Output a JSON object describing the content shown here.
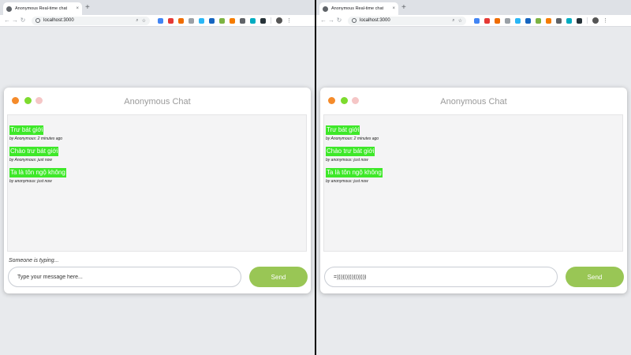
{
  "browser": {
    "tab_title": "Anonymous Real-time chat",
    "url": "localhost:3000",
    "nav": {
      "back": "←",
      "forward": "→",
      "reload": "↻",
      "new_tab": "+",
      "close_tab": "×",
      "zoom": "⌕",
      "bookmark": "☆",
      "menu": "⋮"
    }
  },
  "extensions": [
    "#4285f4",
    "#e53935",
    "#ef6c00",
    "#9aa0a6",
    "#29b6f6",
    "#1565c0",
    "#7cb342",
    "#f57c00",
    "#5f6368",
    "#00acc1",
    "#263238"
  ],
  "panes": [
    {
      "chat_title": "Anonymous Chat",
      "messages": [
        {
          "text": "Trư bát giới",
          "meta": "by Anonymous: 2 minutes ago"
        },
        {
          "text": "Chào trư bát giới",
          "meta": "by Anonymous: just now"
        },
        {
          "text": "Ta là tôn ngộ không",
          "meta": "by anonymous: just now"
        }
      ],
      "typing_status": "Someone is typing...",
      "input_value": "",
      "input_placeholder": "Type your message here...",
      "send_label": "Send"
    },
    {
      "chat_title": "Anonymous Chat",
      "messages": [
        {
          "text": "Trư bát giới",
          "meta": "by Anonymous: 2 minutes ago"
        },
        {
          "text": "Chào trư bát giới",
          "meta": "by anonymous: just now"
        },
        {
          "text": "Ta là tôn ngộ không",
          "meta": "by anonymous: just now"
        }
      ],
      "typing_status": "",
      "input_value": "=))))))))))))))))",
      "input_placeholder": "Type your message here...",
      "send_label": "Send"
    }
  ],
  "colors": {
    "bubble": "#3ee829",
    "send": "#99c655",
    "dot_orange": "#f58b2a",
    "dot_green": "#7ddb2e",
    "dot_pink": "#f5c6c6"
  }
}
